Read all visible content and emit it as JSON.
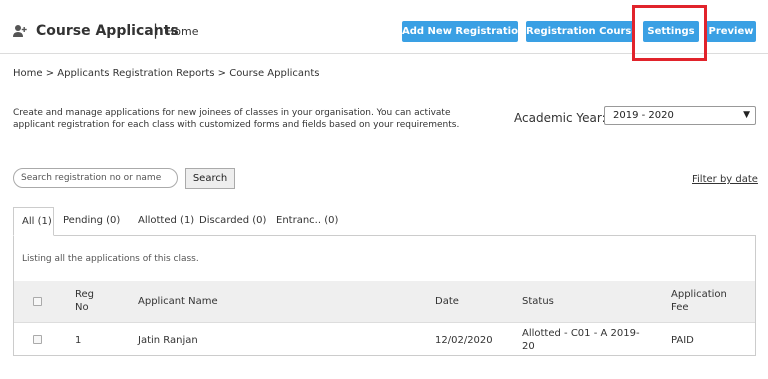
{
  "header": {
    "title": "Course Applicants",
    "separator": "|",
    "home_link": "Home",
    "buttons": {
      "add_new_registration": "Add New Registration",
      "registration_courses": "Registration Courses",
      "settings": "Settings",
      "preview": "Preview"
    }
  },
  "breadcrumb": "Home > Applicants Registration Reports > Course Applicants",
  "description": "Create and manage applications for new joinees of classes in your organisation. You can activate applicant registration for each class with customized forms and fields based on your requirements.",
  "academic_year": {
    "label": "Academic Year:",
    "value": "2019 - 2020"
  },
  "search": {
    "placeholder": "Search registration no or name",
    "button_label": "Search"
  },
  "filter_link": "Filter by date",
  "tabs": [
    {
      "label": "All (1)"
    },
    {
      "label": "Pending (0)"
    },
    {
      "label": "Allotted (1)"
    },
    {
      "label": "Discarded (0)"
    },
    {
      "label": "Entranc.. (0)"
    }
  ],
  "panel_message": "Listing all the applications of this class.",
  "table": {
    "headers": {
      "reg_line1": "Reg",
      "reg_line2": "No",
      "applicant_name": "Applicant Name",
      "date": "Date",
      "status": "Status",
      "fee_line1": "Application",
      "fee_line2": "Fee"
    },
    "rows": [
      {
        "reg_no": "1",
        "name": "Jatin Ranjan",
        "date": "12/02/2020",
        "status_line1": "Allotted - C01 - A 2019-",
        "status_line2": "20",
        "fee": "PAID"
      }
    ]
  },
  "colors": {
    "primary_button": "#3aa0e4",
    "highlight_box": "#e1232b"
  },
  "icons": {
    "header_icon": "user-add-icon",
    "select_caret": "caret-down-icon"
  }
}
